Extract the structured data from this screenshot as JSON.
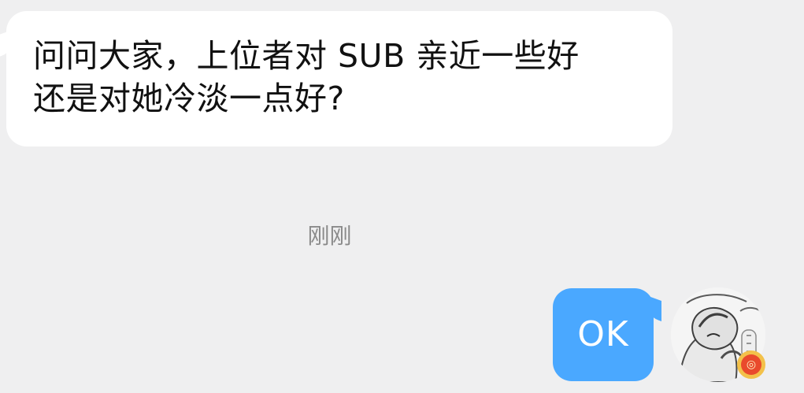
{
  "conversation": {
    "incoming_message": "问问大家，上位者对 SUB 亲近一些好\n还是对她冷淡一点好?",
    "timestamp": "刚刚",
    "outgoing_message": "OK"
  },
  "colors": {
    "background": "#efeff0",
    "incoming_bubble": "#ffffff",
    "outgoing_bubble": "#4aa8ff",
    "incoming_text": "#111111",
    "outgoing_text": "#ffffff",
    "timestamp_text": "#8a8a8a"
  },
  "icons": {
    "avatar": "user-avatar-illustration",
    "badge": "user-badge-icon"
  }
}
